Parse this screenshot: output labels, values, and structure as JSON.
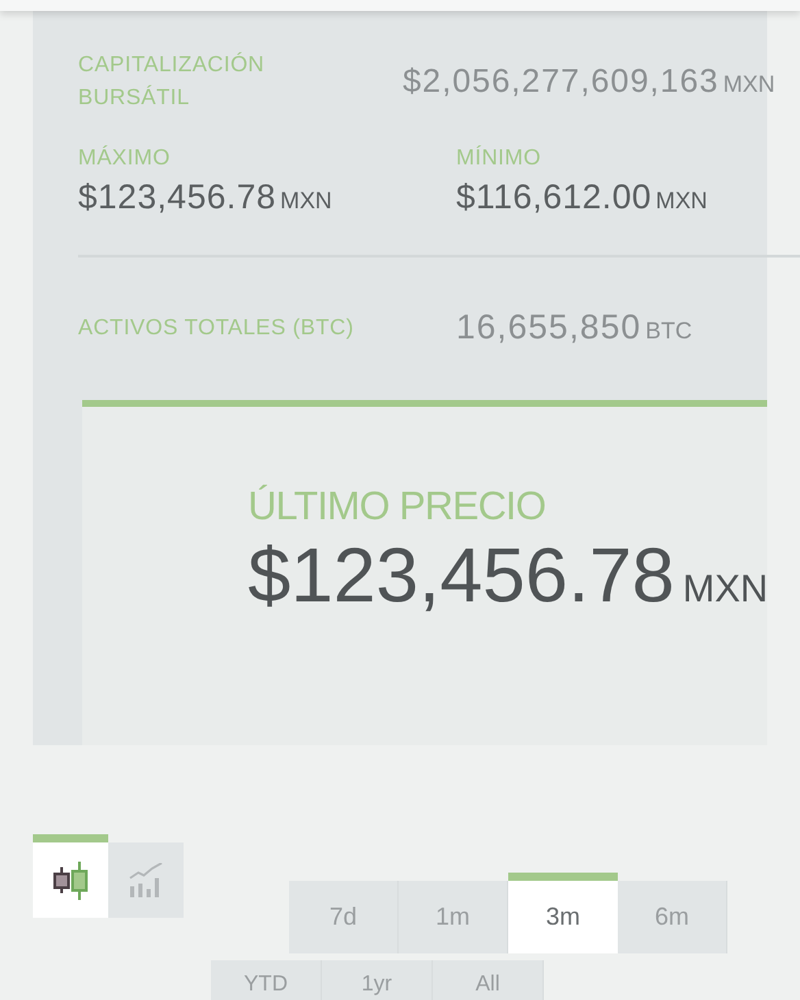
{
  "stats": {
    "market_cap": {
      "label": "CAPITALIZACIÓN BURSÁTIL",
      "value": "$2,056,277,609,163",
      "unit": "MXN"
    },
    "high": {
      "label": "MÁXIMO",
      "value": "$123,456.78",
      "unit": "MXN"
    },
    "low": {
      "label": "MÍNIMO",
      "value": "$116,612.00",
      "unit": "MXN"
    },
    "total_assets": {
      "label": "ACTIVOS TOTALES (BTC)",
      "value": "16,655,850",
      "unit": "BTC"
    }
  },
  "last_price": {
    "label": "ÚLTIMO PRECIO",
    "value": "$123,456.78",
    "unit": "MXN"
  },
  "chart_types": [
    {
      "kind": "candlestick",
      "selected": true
    },
    {
      "kind": "line",
      "selected": false
    }
  ],
  "periods": [
    {
      "label": "7d",
      "selected": false
    },
    {
      "label": "1m",
      "selected": false
    },
    {
      "label": "3m",
      "selected": true
    },
    {
      "label": "6m",
      "selected": false
    },
    {
      "label": "YTD",
      "selected": false
    },
    {
      "label": "1yr",
      "selected": false
    },
    {
      "label": "All",
      "selected": false
    }
  ]
}
